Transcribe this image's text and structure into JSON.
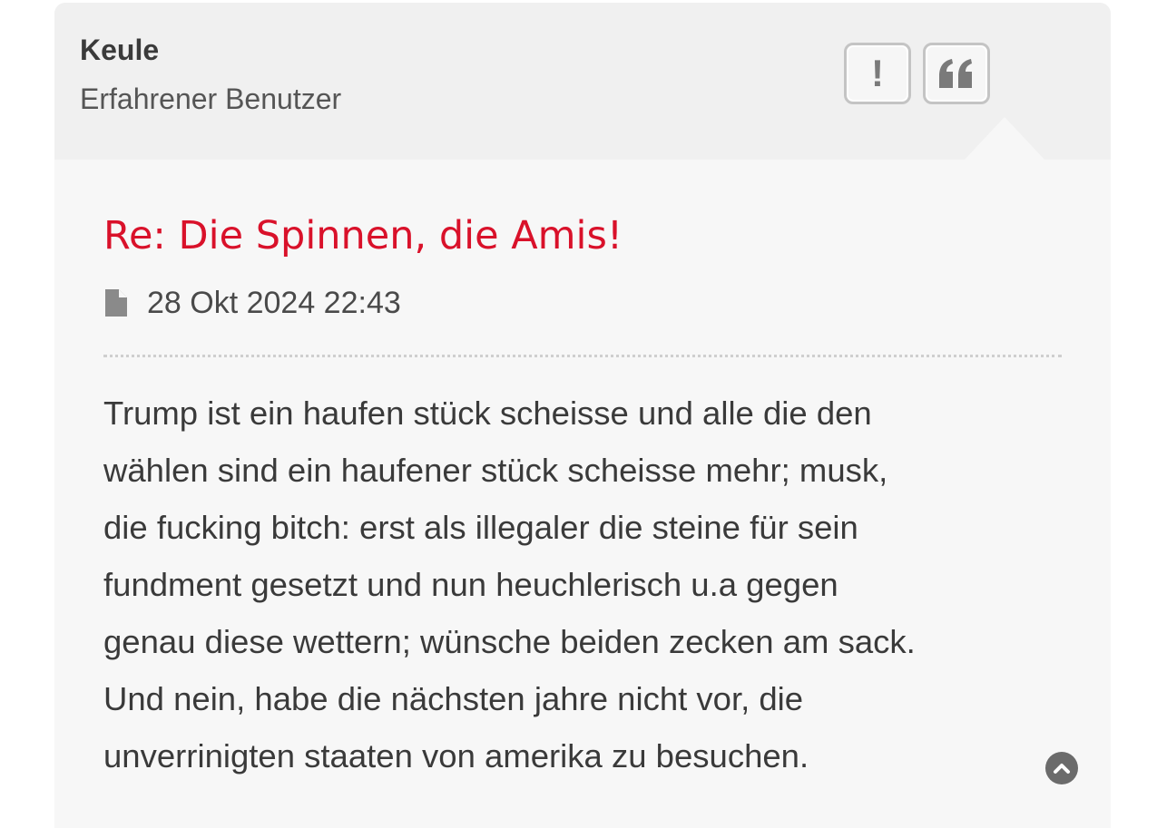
{
  "author": {
    "name": "Keule",
    "rank": "Erfahrener Benutzer"
  },
  "actions": {
    "report_icon": "exclamation-icon",
    "report_glyph": "!",
    "quote_icon": "quote-icon"
  },
  "post": {
    "title": "Re: Die Spinnen, die Amis!",
    "date_icon": "file-icon",
    "date": "28 Okt 2024 22:43",
    "body_lines": [
      "Trump ist ein haufen stück scheisse und alle die den",
      "wählen sind ein haufener stück scheisse mehr; musk,",
      "die fucking bitch: erst als illegaler die steine für sein",
      "fundment gesetzt und nun heuchlerisch u.a gegen",
      "genau diese wettern; wünsche beiden zecken am sack.",
      "Und nein, habe die nächsten jahre nicht vor, die",
      "unverrinigten staaten von amerika zu besuchen."
    ]
  },
  "navigation": {
    "back_to_top_icon": "chevron-up-icon"
  },
  "colors": {
    "title": "#d9112a",
    "header_bg": "#f0f0f0",
    "post_bg": "#f7f7f7",
    "text": "#3a3a3a",
    "icon": "#7a7a7a"
  }
}
